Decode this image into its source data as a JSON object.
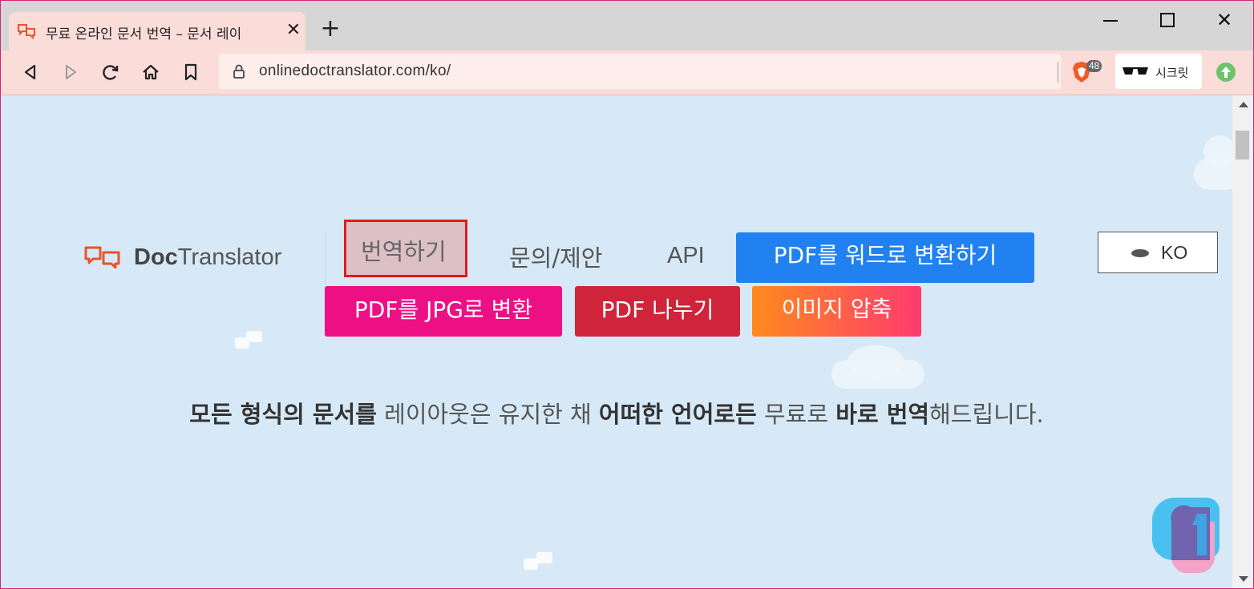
{
  "browser": {
    "tab": {
      "title": "무료 온라인 문서 번역 – 문서 레이",
      "close": "✕"
    },
    "new_tab": "+",
    "window_controls": {
      "close": "✕"
    },
    "address": {
      "url": "onlinedoctranslator.com/ko/"
    },
    "brave_badge_count": "48",
    "incognito_label": "시크릿",
    "accent_color": "#fadcd9"
  },
  "site": {
    "logo": {
      "bold": "Doc",
      "rest": "Translator"
    },
    "nav": {
      "translate": "번역하기",
      "contact": "문의/제안",
      "api": "API"
    },
    "tools": {
      "pdf_to_word": "PDF를 워드로 변환하기",
      "pdf_to_jpg": "PDF를 JPG로 변환",
      "split_pdf": "PDF 나누기",
      "compress_image": "이미지 압축"
    },
    "language": {
      "label": "KO"
    },
    "tagline": {
      "p1": "모든 형식의 문서를",
      "p2": " 레이아웃은 유지한 채 ",
      "p3": "어떠한 언어로든",
      "p4": " 무료로 ",
      "p5": "바로 번역",
      "p6": "해드립니다."
    },
    "colors": {
      "background": "#d7e9f6",
      "pdf_to_word": "#2181f0",
      "pdf_to_jpg": "#ed1085",
      "split_pdf": "#d0243a",
      "compress_gradient_start": "#ff8a1c",
      "compress_gradient_end": "#fe3b70",
      "highlight_border": "#e01b1b"
    }
  }
}
